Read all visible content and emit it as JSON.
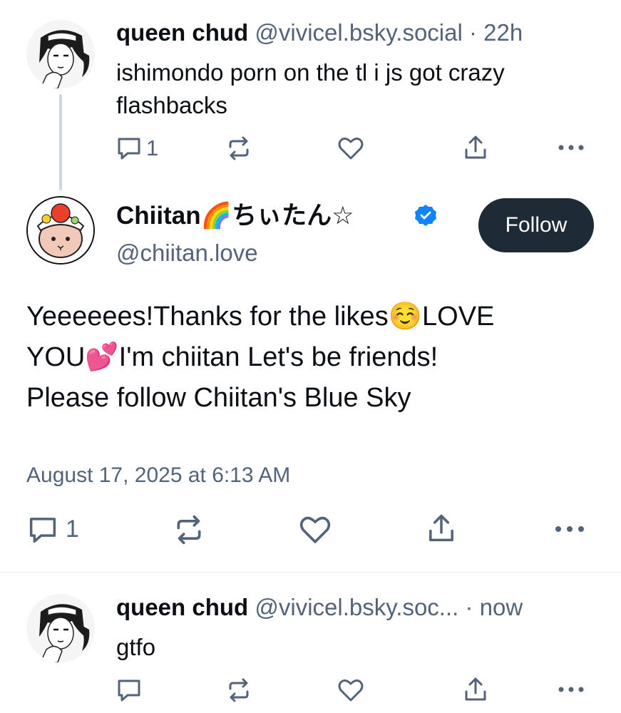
{
  "parent_post": {
    "display_name": "queen chud",
    "handle": "@vivicel.bsky.social",
    "separator": "·",
    "time": "22h",
    "text_line1": "ishimondo porn on the tl i js got crazy",
    "text_line2": "flashbacks",
    "reply_count": "1",
    "avatar_icon": "manga-portrait-avatar"
  },
  "focused_post": {
    "display_name": "Chiitan🌈ちぃたん☆",
    "handle": "@chiitan.love",
    "verified_icon": "verified-badge-icon",
    "follow_label": "Follow",
    "text_line1": "Yeeeeees!Thanks for the likes☺️LOVE",
    "text_line2": "YOU💕I'm chiitan Let's be friends!",
    "text_line3": "Please follow Chiitan's Blue Sky",
    "timestamp": "August 17, 2025 at 6:13 AM",
    "reply_count": "1",
    "avatar_icon": "chiitan-mascot-avatar"
  },
  "reply_post": {
    "display_name": "queen chud",
    "handle": "@vivicel.bsky.soc...",
    "separator": "·",
    "time": "now",
    "text": "gtfo",
    "avatar_icon": "manga-portrait-avatar"
  },
  "colors": {
    "text": "#0b0f14",
    "muted": "#53647a",
    "follow_bg": "#1f2a37",
    "verified": "#1083fe",
    "divider": "#e3e8ee"
  }
}
